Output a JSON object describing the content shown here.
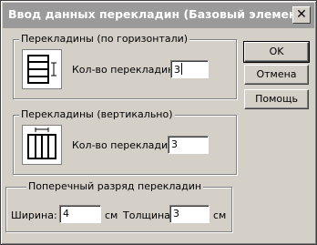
{
  "window": {
    "title": "Ввод данных перекладин (Базовый элемент)"
  },
  "horizontal": {
    "group_label": "Перекладины (по горизонтали)",
    "count_label": "Кол-во перекладин:",
    "count_value": "3"
  },
  "vertical": {
    "group_label": "Перекладины (вертикально)",
    "count_label": "Кол-во перекладин:",
    "count_value": "3"
  },
  "cross": {
    "group_label": "Поперечный разряд перекладин",
    "width_label": "Ширина:",
    "width_value": "4",
    "width_unit": "см",
    "thickness_label": "Толщина:",
    "thickness_value": "3",
    "thickness_unit": "см"
  },
  "buttons": {
    "ok": "OK",
    "cancel": "Отмена",
    "help": "Помощь"
  },
  "icons": {
    "close": "close-icon",
    "horizontal": "horizontal-bars-icon",
    "vertical": "vertical-bars-icon"
  }
}
